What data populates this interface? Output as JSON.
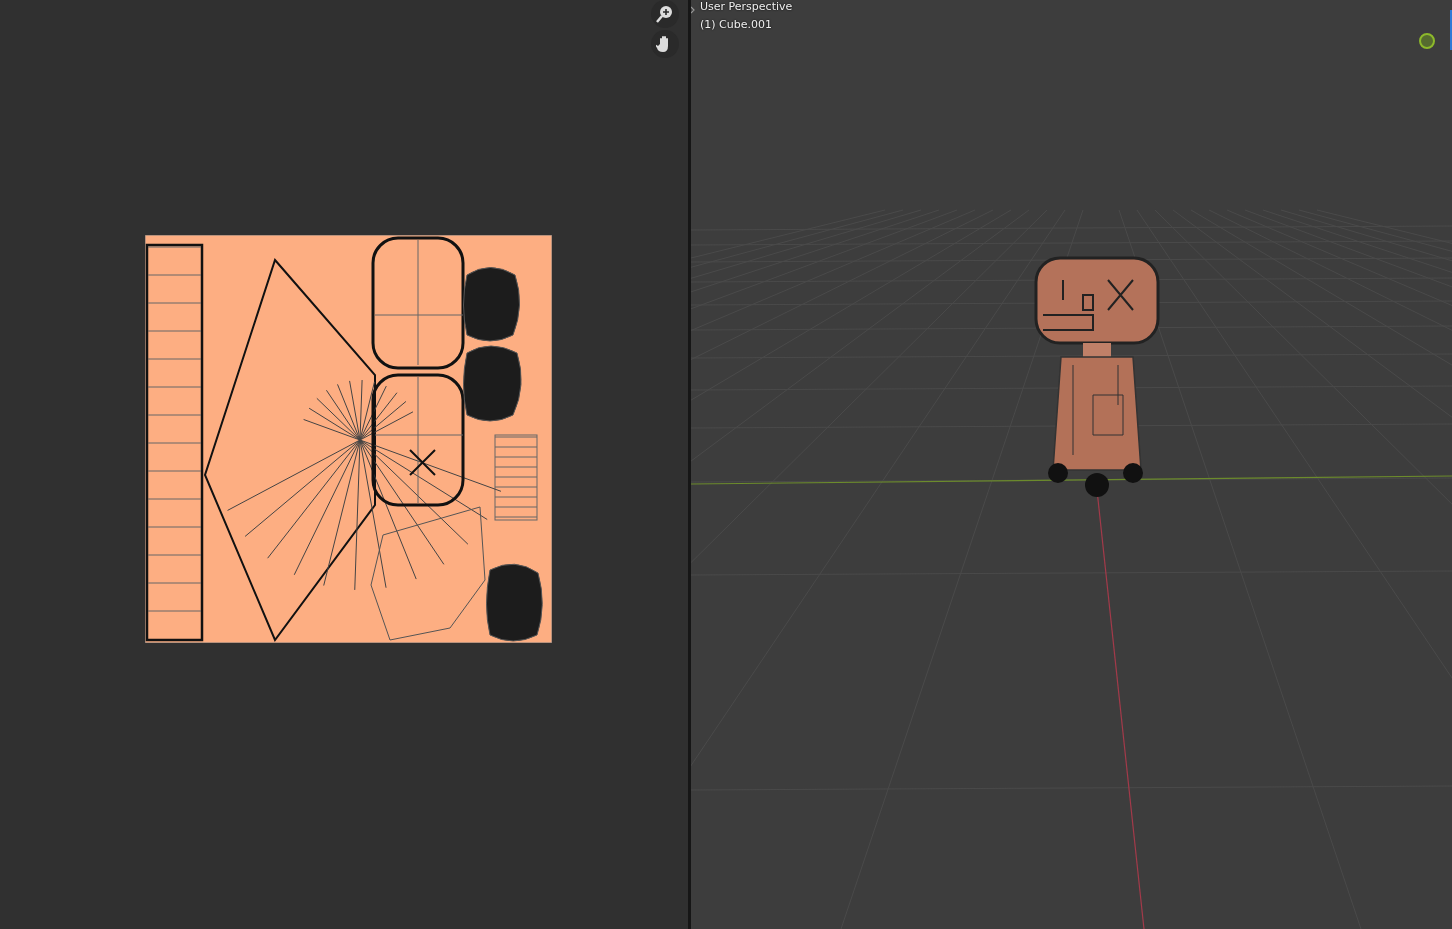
{
  "viewport": {
    "view_name": "User Perspective",
    "active_object": "(1) Cube.001"
  }
}
